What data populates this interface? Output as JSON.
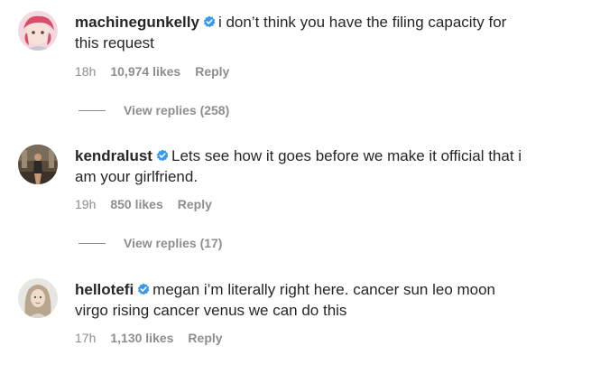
{
  "comments": [
    {
      "username": "machinegunkelly",
      "text": "i don’t think you have the filing capacity for this request",
      "time": "18h",
      "likes": "10,974 likes",
      "reply": "Reply",
      "view_replies": "View replies (258)"
    },
    {
      "username": "kendralust",
      "text": "Lets see how it goes before we make it official that i am your girlfriend.",
      "time": "19h",
      "likes": "850 likes",
      "reply": "Reply",
      "view_replies": "View replies (17)"
    },
    {
      "username": "hellotefi",
      "text": "megan i’m literally right here. cancer sun leo moon virgo rising cancer venus we can do this",
      "time": "17h",
      "likes": "1,130 likes",
      "reply": "Reply"
    }
  ],
  "colors": {
    "verified": "#3897f0",
    "muted": "#8e8e8e",
    "text": "#262626"
  }
}
